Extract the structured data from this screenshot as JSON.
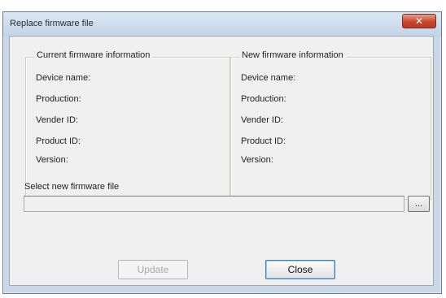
{
  "window": {
    "title": "Replace firmware file",
    "close_glyph": "✕"
  },
  "current_info": {
    "legend": "Current firmware information",
    "device_name": "Device name:",
    "production": "Production:",
    "vendor_id": "Vender ID:",
    "product_id": "Product ID:",
    "version": "Version:"
  },
  "new_info": {
    "legend": "New firmware information",
    "device_name": "Device name:",
    "production": "Production:",
    "vendor_id": "Vender ID:",
    "product_id": "Product ID:",
    "version": "Version:"
  },
  "select": {
    "label": "Select new firmware file",
    "value": "",
    "browse_label": "..."
  },
  "buttons": {
    "update": "Update",
    "close": "Close"
  }
}
